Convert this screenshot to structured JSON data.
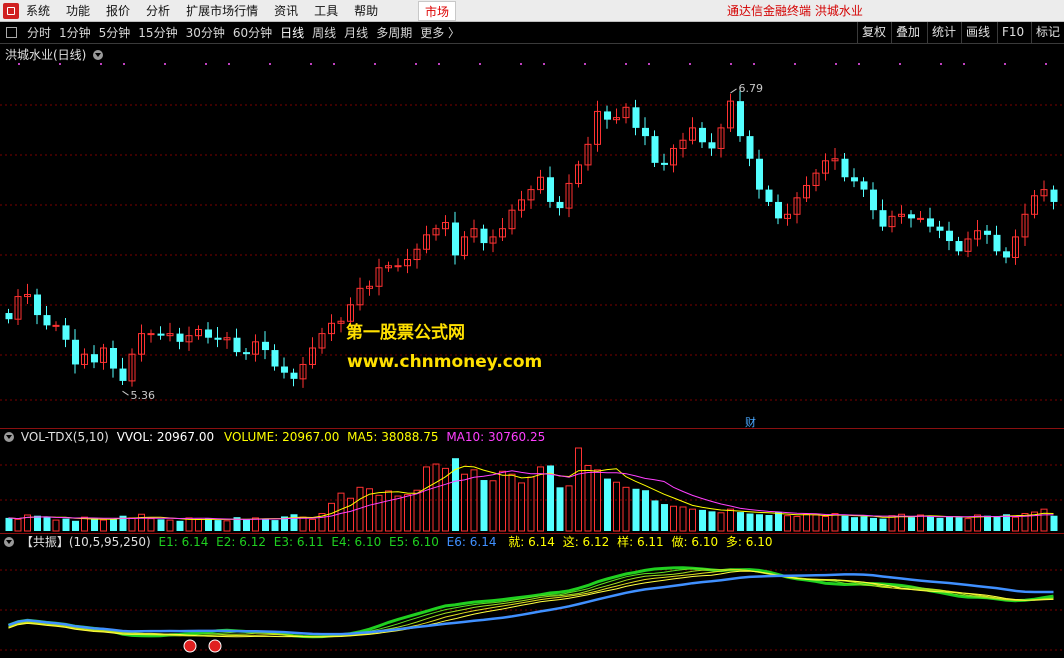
{
  "menu": {
    "items": [
      "系统",
      "功能",
      "报价",
      "分析",
      "扩展市场行情",
      "资讯",
      "工具",
      "帮助"
    ],
    "market_tab": "市场",
    "brand": "通达信金融终端  洪城水业"
  },
  "toolbar": {
    "periods": [
      "分时",
      "1分钟",
      "5分钟",
      "15分钟",
      "30分钟",
      "60分钟",
      "日线",
      "周线",
      "月线",
      "多周期",
      "更多 〉"
    ],
    "active_period": "日线",
    "right_buttons": [
      "复权",
      "叠加",
      "统计",
      "画线",
      "F10",
      "标记"
    ]
  },
  "main_chart": {
    "title": "洪城水业(日线)",
    "high_label": "6.79",
    "low_label": "5.36",
    "cai_marker": "财",
    "watermark_line1": "第一股票公式网",
    "watermark_line2": "www.chnmoney.com"
  },
  "vol_indicator": {
    "name": "VOL-TDX(5,10)",
    "vvol": "VVOL: 20967.00",
    "volume": "VOLUME: 20967.00",
    "ma5": "MA5: 38088.75",
    "ma10": "MA10: 30760.25"
  },
  "gz_indicator": {
    "name": "【共振】(10,5,95,250)",
    "e1": "E1: 6.14",
    "e2": "E2: 6.12",
    "e3": "E3: 6.11",
    "e4": "E4: 6.10",
    "e5": "E5: 6.10",
    "e6": "E6: 6.14",
    "jiu": "就: 6.14",
    "zhe": "这: 6.12",
    "yang": "样: 6.11",
    "zuo": "做: 6.10",
    "duo": "多: 6.10"
  },
  "colors": {
    "up": "#ff3232",
    "down": "#54ffff",
    "grid": "#7a0000",
    "vol_label": "#ffffff",
    "ma5": "#ffff00",
    "ma10": "#ff40ff",
    "e_green": "#20d020",
    "e6_blue": "#4090ff",
    "accent_yellow": "#ffe000"
  },
  "chart_data": {
    "type": "candlestick",
    "price_ylim": [
      5.2,
      6.95
    ],
    "open": [
      5.72,
      5.69,
      5.8,
      5.81,
      5.71,
      5.66,
      5.66,
      5.59,
      5.47,
      5.52,
      5.48,
      5.55,
      5.45,
      5.39,
      5.52,
      5.62,
      5.62,
      5.61,
      5.62,
      5.58,
      5.61,
      5.64,
      5.6,
      5.59,
      5.6,
      5.53,
      5.52,
      5.58,
      5.54,
      5.46,
      5.43,
      5.4,
      5.47,
      5.55,
      5.62,
      5.67,
      5.68,
      5.76,
      5.84,
      5.85,
      5.94,
      5.95,
      5.95,
      5.98,
      6.03,
      6.1,
      6.13,
      6.16,
      6.0,
      6.09,
      6.13,
      6.06,
      6.09,
      6.13,
      6.22,
      6.27,
      6.32,
      6.38,
      6.26,
      6.23,
      6.35,
      6.44,
      6.54,
      6.7,
      6.66,
      6.67,
      6.72,
      6.62,
      6.58,
      6.45,
      6.44,
      6.52,
      6.56,
      6.62,
      6.55,
      6.52,
      6.62,
      6.75,
      6.58,
      6.47,
      6.32,
      6.26,
      6.18,
      6.2,
      6.28,
      6.34,
      6.4,
      6.46,
      6.47,
      6.38,
      6.36,
      6.32,
      6.22,
      6.14,
      6.19,
      6.2,
      6.18,
      6.18,
      6.14,
      6.12,
      6.07,
      6.02,
      6.08,
      6.12,
      6.1,
      6.02,
      5.99,
      6.09,
      6.2,
      6.29,
      6.32
    ],
    "close": [
      5.69,
      5.8,
      5.81,
      5.71,
      5.66,
      5.66,
      5.59,
      5.47,
      5.52,
      5.48,
      5.55,
      5.45,
      5.39,
      5.52,
      5.62,
      5.62,
      5.61,
      5.62,
      5.58,
      5.61,
      5.64,
      5.6,
      5.59,
      5.6,
      5.53,
      5.52,
      5.58,
      5.54,
      5.46,
      5.43,
      5.4,
      5.47,
      5.55,
      5.62,
      5.67,
      5.68,
      5.76,
      5.84,
      5.85,
      5.94,
      5.95,
      5.95,
      5.98,
      6.03,
      6.1,
      6.13,
      6.16,
      6.0,
      6.09,
      6.13,
      6.06,
      6.09,
      6.13,
      6.22,
      6.27,
      6.32,
      6.38,
      6.26,
      6.23,
      6.35,
      6.44,
      6.54,
      6.7,
      6.66,
      6.67,
      6.72,
      6.62,
      6.58,
      6.45,
      6.44,
      6.52,
      6.56,
      6.62,
      6.55,
      6.52,
      6.62,
      6.75,
      6.58,
      6.47,
      6.32,
      6.26,
      6.18,
      6.2,
      6.28,
      6.34,
      6.4,
      6.46,
      6.47,
      6.38,
      6.36,
      6.32,
      6.22,
      6.14,
      6.19,
      6.2,
      6.18,
      6.18,
      6.14,
      6.12,
      6.07,
      6.02,
      6.08,
      6.12,
      6.1,
      6.02,
      5.99,
      6.09,
      6.2,
      6.29,
      6.32,
      6.26
    ],
    "volume": [
      18000,
      16000,
      22000,
      21000,
      20000,
      15000,
      17000,
      14000,
      19000,
      17000,
      15000,
      16000,
      21000,
      18000,
      23000,
      17000,
      16000,
      15000,
      14000,
      18000,
      16000,
      17000,
      15000,
      14000,
      19000,
      16000,
      18000,
      17000,
      15000,
      20000,
      23000,
      19000,
      16000,
      24000,
      38000,
      52000,
      45000,
      60000,
      58000,
      49000,
      55000,
      48000,
      50000,
      56000,
      88000,
      92000,
      86000,
      100000,
      78000,
      84000,
      70000,
      69000,
      82000,
      78000,
      66000,
      74000,
      88000,
      90000,
      60000,
      62000,
      114000,
      90000,
      84000,
      72000,
      67000,
      60000,
      58000,
      56000,
      42000,
      37000,
      34000,
      33000,
      30000,
      29000,
      27000,
      25000,
      30000,
      26000,
      24000,
      23000,
      22000,
      26000,
      21000,
      20000,
      23000,
      22000,
      20000,
      24000,
      21000,
      19000,
      20000,
      18000,
      17000,
      21000,
      23000,
      19000,
      22000,
      20000,
      18000,
      20000,
      19000,
      17000,
      22000,
      21000,
      20000,
      23000,
      19000,
      24000,
      26000,
      30000,
      20967
    ],
    "series": [
      {
        "name": "E1",
        "last": 6.14
      },
      {
        "name": "E2",
        "last": 6.12
      },
      {
        "name": "E3",
        "last": 6.11
      },
      {
        "name": "E4",
        "last": 6.1
      },
      {
        "name": "E5",
        "last": 6.1
      },
      {
        "name": "E6",
        "last": 6.14
      }
    ]
  }
}
